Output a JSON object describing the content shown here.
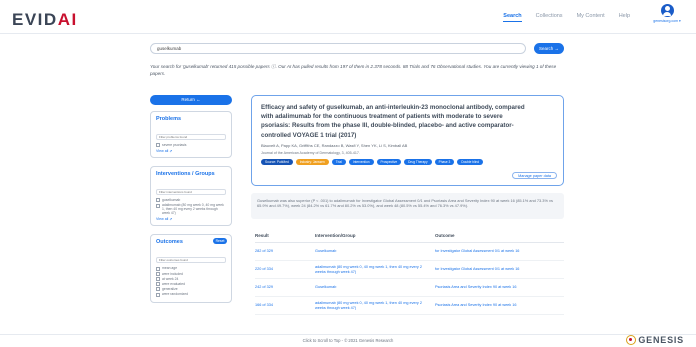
{
  "header": {
    "logo_main": "EVID",
    "logo_accent": "AI",
    "nav": [
      "Search",
      "Collections",
      "My Content",
      "Help"
    ],
    "active_nav": "Search",
    "user_label": "genesisorg.com ▾"
  },
  "search": {
    "value": "guselkumab",
    "button_label": "Search →"
  },
  "summary": "Your search for 'guselkumab' returned 415 possible papers ⓘ. Our AI has pulled results from 197 of them in 2.378 seconds. 88 Trials and 76 Observational studies. You are currently viewing 1 of these papers.",
  "sidebar": {
    "return_label": "Return ←",
    "problems": {
      "title": "Problems",
      "placeholder": "Filter problems found",
      "options": [
        "severe psoriasis"
      ],
      "view_all": "View all ⇗"
    },
    "interventions": {
      "title": "Interventions / Groups",
      "placeholder": "Filter interventions found",
      "options": [
        "guselkumab",
        "adalimumab (80 mg week 0, 40 mg week 1, then 40 mg every 2 weeks through week 47)"
      ],
      "view_all": "View all ⇗"
    },
    "outcomes": {
      "title": "Outcomes",
      "reset_label": "Reset",
      "placeholder": "Filter outcomes found",
      "options": [
        "mean age",
        "were included",
        "at week 24",
        "were evaluated",
        "generalize",
        "were randomized"
      ]
    }
  },
  "paper": {
    "title": "Efficacy and safety of guselkumab, an anti-interleukin-23 monoclonal antibody, compared with adalimumab for the continuous treatment of patients with moderate to severe psoriasis: Results from the phase III, double-blinded, placebo- and active comparator-controlled VOYAGE 1 trial (2017)",
    "authors": "Blauvelt A, Papp KA, Griffiths CE, Randazzo B, Wasfi Y, Shen YK, Li S, Kimball AB",
    "journal": "Journal of the American Academy of Dermatology, 3, 405-417.",
    "tags": [
      {
        "label": "Source: PubMed",
        "style": "dark"
      },
      {
        "label": "Industry: Janssen",
        "style": "orange"
      },
      {
        "label": "Trial",
        "style": "blue"
      },
      {
        "label": "Intervention",
        "style": "blue"
      },
      {
        "label": "Prospective",
        "style": "blue"
      },
      {
        "label": "Drug Therapy",
        "style": "blue"
      },
      {
        "label": "Phase 3",
        "style": "blue"
      },
      {
        "label": "Double blind",
        "style": "blue"
      }
    ],
    "manage_label": "Manage paper data"
  },
  "conclusion": "Guselkumab was also superior (P < .001) to adalimumab for Investigator Global Assessment 0/1 and Psoriasis Area and Severity Index 90 at week 16 (85.1% and 73.3% vs 65.9% and 49.7%), week 24 (84.2% vs 61.7% and 80.2% vs 53.0%), and week 48 (80.5% vs 55.4% and 76.3% vs 47.9%).",
  "results": {
    "headers": [
      "Result",
      "Intervention/Group",
      "Outcome"
    ],
    "rows": [
      {
        "result": "282 of 329",
        "intervention": "Guselkumab",
        "outcome": "for Investigator Global Assessment 0/1 at week 16"
      },
      {
        "result": "220 of 334",
        "intervention": "adalimumab (80 mg week 0, 40 mg week 1, then 40 mg every 2 weeks through week 47)",
        "outcome": "for Investigator Global Assessment 0/1 at week 16"
      },
      {
        "result": "242 of 329",
        "intervention": "Guselkumab",
        "outcome": "Psoriasis Area and Severity Index 90 at week 16"
      },
      {
        "result": "166 of 334",
        "intervention": "adalimumab (80 mg week 0, 40 mg week 1, then 40 mg every 2 weeks through week 47)",
        "outcome": "Psoriasis Area and Severity Index 90 at week 16"
      }
    ]
  },
  "footer": {
    "text": "Click to Scroll to Top - © 2021 Genesis Research",
    "brand": "GENESIS"
  },
  "colors": {
    "primary": "#1a72e8",
    "accent_red": "#c8102e",
    "tag_orange": "#f0a020"
  }
}
